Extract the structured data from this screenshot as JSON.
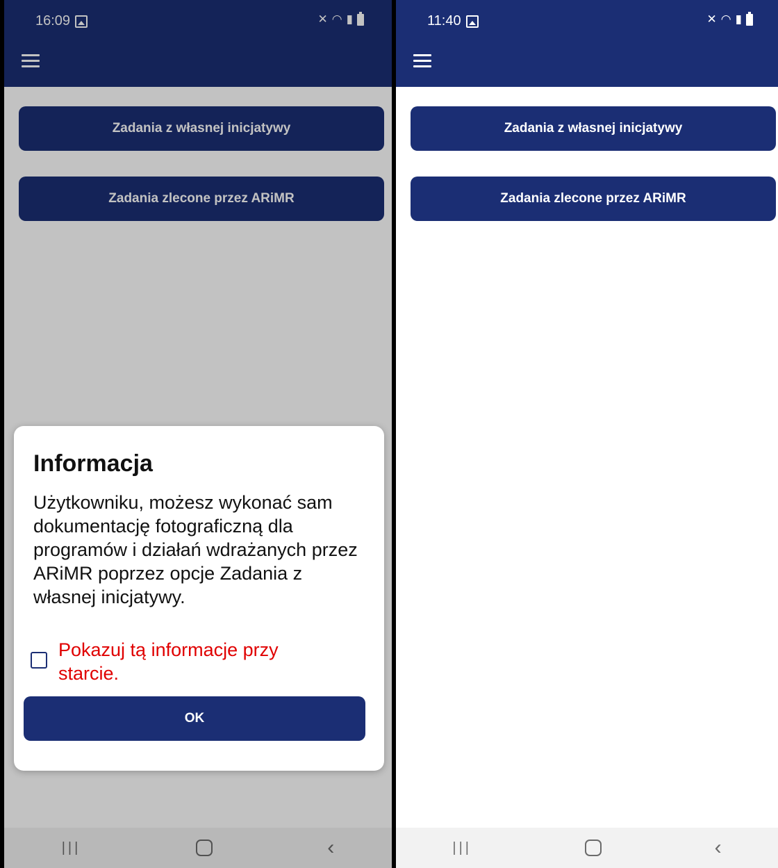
{
  "colors": {
    "primary": "#1b2e74",
    "checkbox_label": "#e00000",
    "nav_bar": "#f2f2f2"
  },
  "left_phone": {
    "status": {
      "time": "16:09"
    },
    "buttons": {
      "own_initiative": "Zadania z własnej inicjatywy",
      "commissioned": "Zadania zlecone przez ARiMR"
    },
    "dialog": {
      "title": "Informacja",
      "body": "Użytkowniku, możesz wykonać sam dokumentację fotograficzną dla programów i działań wdrażanych przez ARiMR poprzez opcje Zadania z własnej inicjatywy.",
      "checkbox_label": "Pokazuj tą informacje przy starcie.",
      "checkbox_checked": false,
      "ok_label": "OK"
    }
  },
  "right_phone": {
    "status": {
      "time": "11:40"
    },
    "buttons": {
      "own_initiative": "Zadania z własnej inicjatywy",
      "commissioned": "Zadania zlecone przez ARiMR"
    }
  },
  "icons": [
    "image-icon",
    "mute-icon",
    "wifi-icon",
    "signal-icon",
    "battery-icon",
    "menu-icon",
    "recent-apps-icon",
    "home-icon",
    "back-icon"
  ]
}
